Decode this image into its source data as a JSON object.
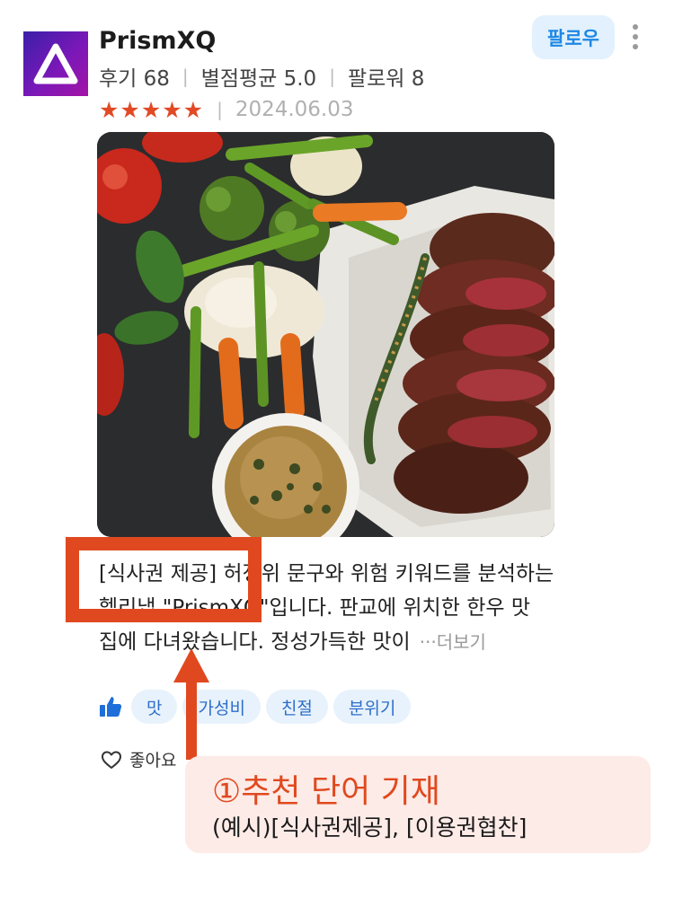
{
  "profile": {
    "username": "PrismXQ",
    "reviews": "후기 68",
    "avg_rating": "별점평균 5.0",
    "followers": "팔로워 8",
    "stars": "★★★★★",
    "date": "2024.06.03"
  },
  "follow_label": "팔로우",
  "review": {
    "line1_prefix": "[식사권 제공]",
    "line1_rest": " 허정위 문구와 위험 키워드를 분석하는",
    "line2": "헬리냅 \"PrismXQ\"입니다. 판교에 위치한 한우 맛",
    "line3": "집에 다녀왔습니다. 정성가득한 맛이",
    "more": "···더보기"
  },
  "tags": [
    "맛",
    "가성비",
    "친절",
    "분위기"
  ],
  "like_label": "좋아요",
  "annotation": {
    "title": "①추천 단어 기재",
    "subtitle": "(예시)[식사권제공], [이용권협찬]",
    "color": "#e0491f"
  },
  "colors": {
    "accent": "#e24a25",
    "follow_bg": "#e2f1fd",
    "follow_text": "#1e88e5",
    "tag_bg": "#e8f2fc",
    "tag_text": "#2d6ec8"
  }
}
